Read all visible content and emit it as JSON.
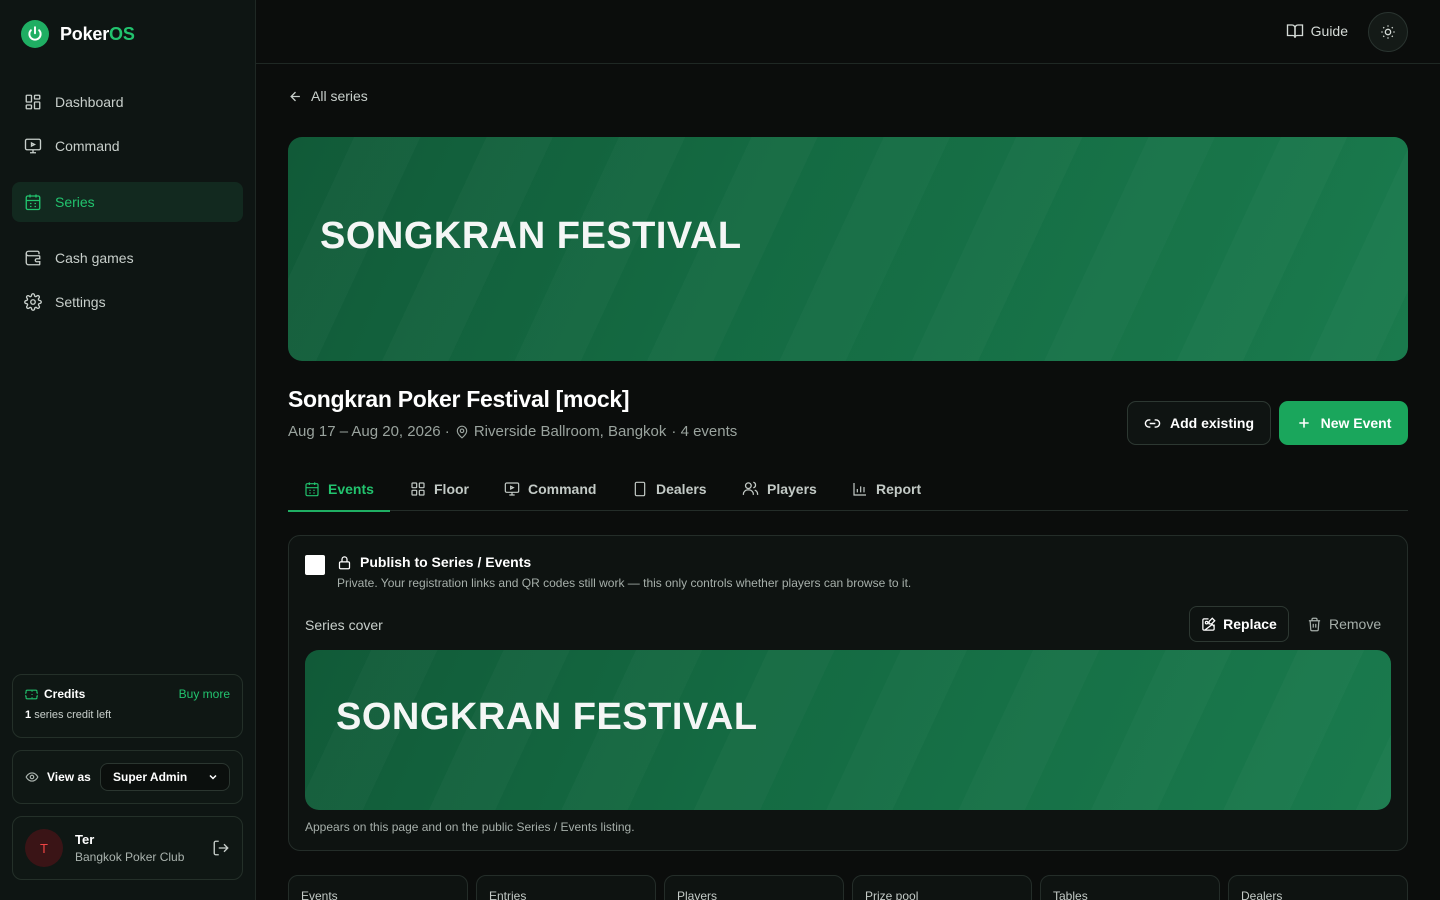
{
  "brand": {
    "name_main": "Poker",
    "name_accent": "OS"
  },
  "sidebar": {
    "items": [
      {
        "label": "Dashboard",
        "icon": "grid-icon"
      },
      {
        "label": "Command",
        "icon": "monitor-icon"
      },
      {
        "label": "Series",
        "icon": "calendar-icon",
        "active": true
      },
      {
        "label": "Cash games",
        "icon": "wallet-icon"
      },
      {
        "label": "Settings",
        "icon": "gear-icon"
      }
    ],
    "credits": {
      "title": "Credits",
      "buy_more": "Buy more",
      "count": "1",
      "suffix": "series credit left"
    },
    "view_as": {
      "label": "View as",
      "selected": "Super Admin"
    },
    "user": {
      "initial": "T",
      "name": "Ter",
      "club": "Bangkok Poker Club"
    }
  },
  "topbar": {
    "guide": "Guide"
  },
  "page": {
    "back_label": "All series",
    "banner_text": "SONGKRAN FESTIVAL",
    "title": "Songkran Poker Festival [mock]",
    "dates": "Aug 17 – Aug 20, 2026 ·",
    "venue": "Riverside Ballroom, Bangkok",
    "events_count": "· 4 events",
    "add_existing": "Add existing",
    "new_event": "New Event"
  },
  "tabs": [
    {
      "label": "Events",
      "active": true
    },
    {
      "label": "Floor"
    },
    {
      "label": "Command"
    },
    {
      "label": "Dealers"
    },
    {
      "label": "Players"
    },
    {
      "label": "Report"
    }
  ],
  "panel": {
    "publish_title": "Publish to Series / Events",
    "publish_desc": "Private. Your registration links and QR codes still work — this only controls whether players can browse to it.",
    "cover_label": "Series cover",
    "replace": "Replace",
    "remove": "Remove",
    "cover_text": "SONGKRAN FESTIVAL",
    "cover_note": "Appears on this page and on the public Series / Events listing."
  },
  "stats": [
    "Events",
    "Entries",
    "Players",
    "Prize pool",
    "Tables",
    "Dealers"
  ],
  "colors": {
    "accent": "#22c36e",
    "button_green": "#1aa65c",
    "banner": "#146a42",
    "background": "#0b0d0c"
  }
}
